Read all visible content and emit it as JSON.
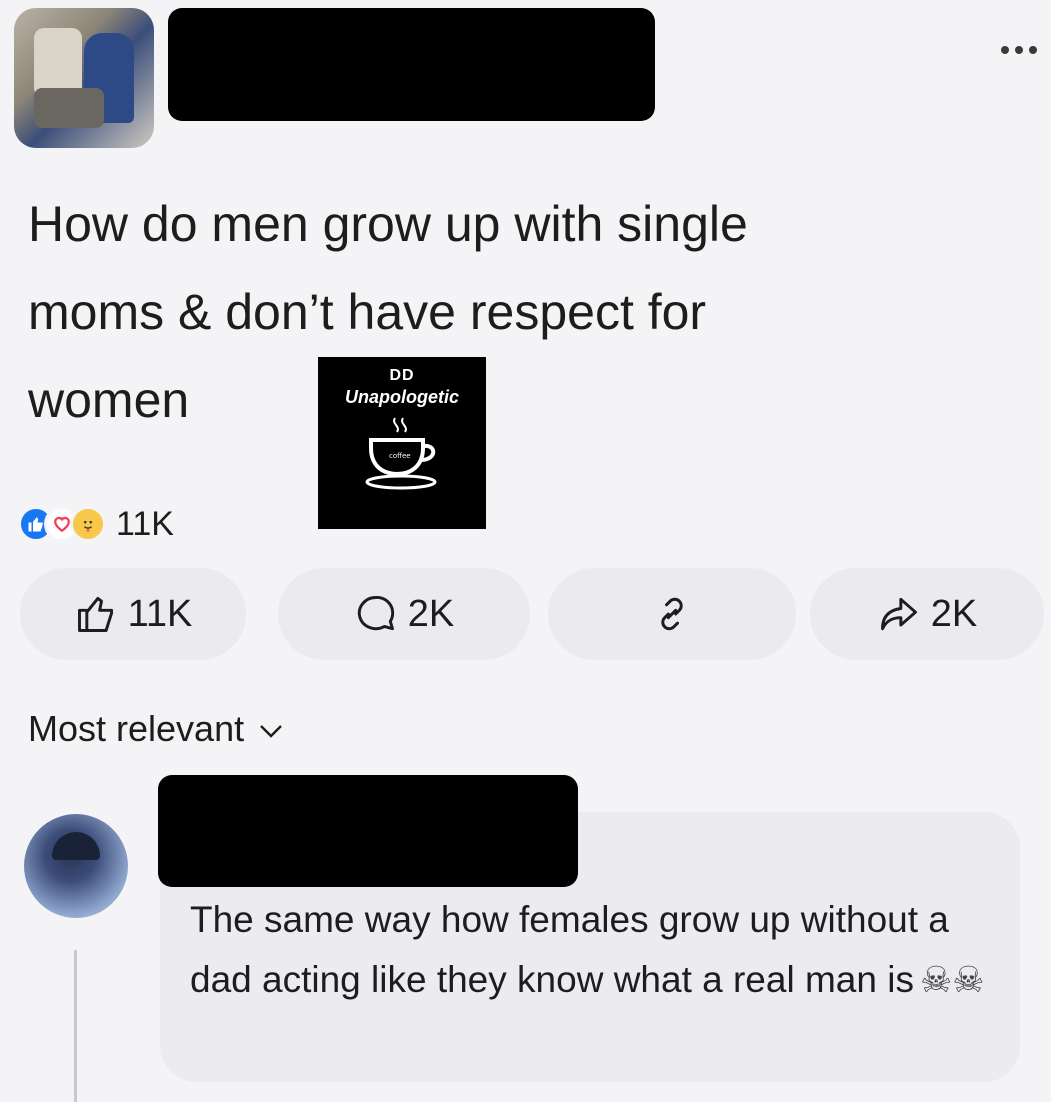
{
  "post": {
    "text": "How do men grow up with single\nmoms & don’t have respect for\nwomen",
    "reaction_count": "11K"
  },
  "watermark": {
    "top": "DD",
    "name": "Unapologetic",
    "cup_text": "coffee"
  },
  "actions": {
    "like_count": "11K",
    "comment_count": "2K",
    "share_count": "2K"
  },
  "sort": {
    "label": "Most relevant"
  },
  "comment": {
    "text": "The same way how females grow up without a dad acting like they know what a real man is",
    "emoji": "☠☠"
  },
  "icons": {
    "more": "more-horizontal-icon",
    "like": "thumbs-up-icon",
    "comment": "comment-bubble-icon",
    "link": "link-icon",
    "share": "share-arrow-icon",
    "chevron": "chevron-down-icon"
  }
}
